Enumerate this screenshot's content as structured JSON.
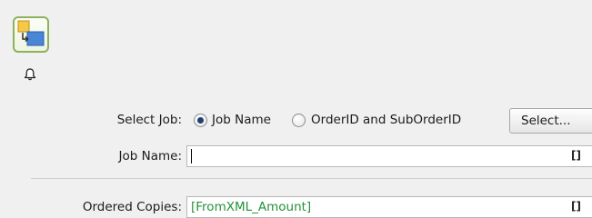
{
  "toolbar": {
    "tool_icon": "flow-element-icon",
    "bell_icon": "bell-icon"
  },
  "form": {
    "select_job": {
      "label": "Select Job:",
      "options": [
        {
          "label": "Job Name",
          "checked": true
        },
        {
          "label": "OrderID and SubOrderID",
          "checked": false
        }
      ],
      "button_label": "Select..."
    },
    "job_name": {
      "label": "Job Name:",
      "value": "",
      "bracket": "[]"
    },
    "ordered_copies": {
      "label": "Ordered Copies:",
      "value": "[FromXML_Amount]",
      "bracket": "[]"
    }
  },
  "colors": {
    "variable_text": "#23913a",
    "icon_border": "#8db15f"
  }
}
